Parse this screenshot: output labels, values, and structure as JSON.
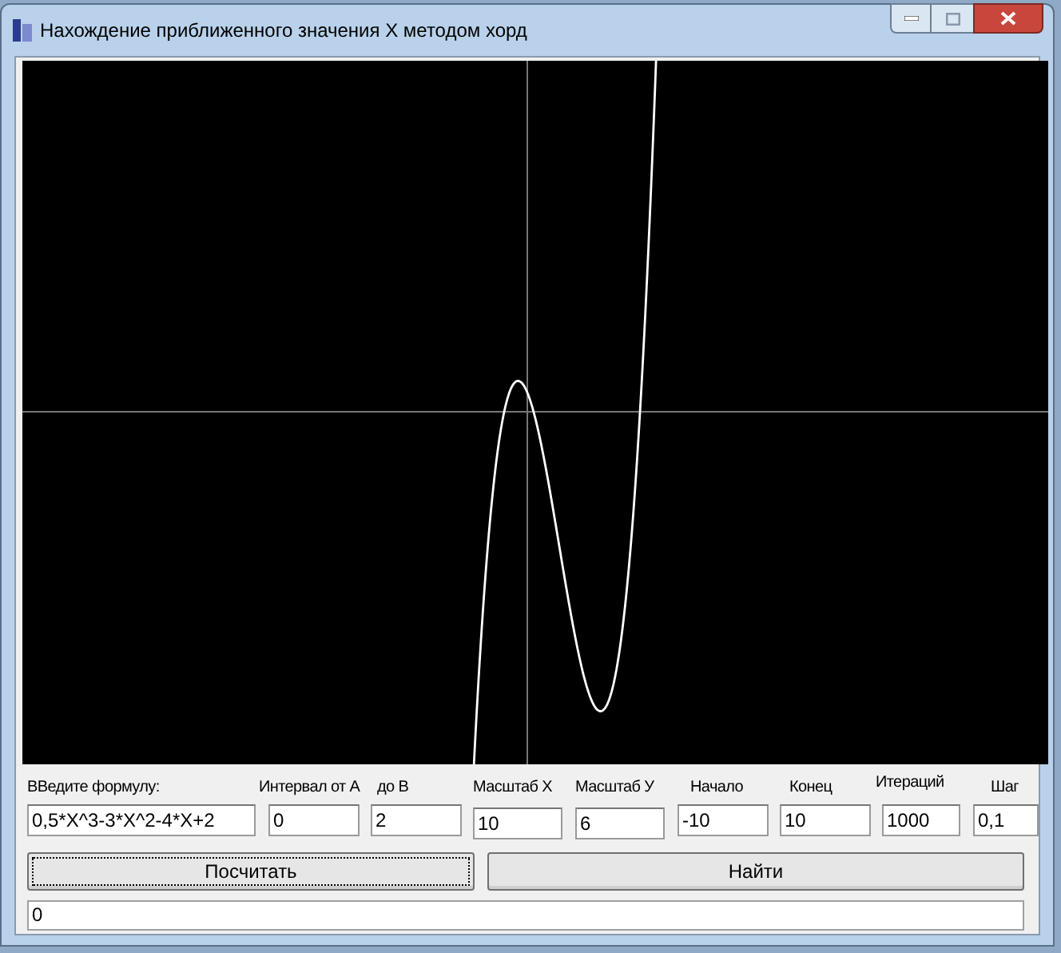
{
  "window": {
    "title": "Нахождение приближенного значения X методом хорд"
  },
  "fields": [
    {
      "label": "ВВедите формулу:",
      "value": "0,5*X^3-3*X^2-4*X+2"
    },
    {
      "label": "Интервал от А",
      "value": "0"
    },
    {
      "label": "до В",
      "value": "2"
    },
    {
      "label": "Масштаб X",
      "value": "10"
    },
    {
      "label": "Масштаб У",
      "value": "6"
    },
    {
      "label": "Начало",
      "value": "-10"
    },
    {
      "label": "Конец",
      "value": "10"
    },
    {
      "label": "Итераций",
      "value": "1000"
    },
    {
      "label": "Шаг",
      "value": "0,1"
    }
  ],
  "buttons": [
    {
      "label": "Посчитать",
      "focused": true
    },
    {
      "label": "Найти",
      "focused": false
    }
  ],
  "result": {
    "value": "0"
  }
}
